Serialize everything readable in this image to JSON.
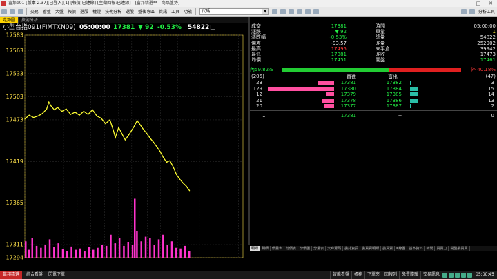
{
  "window": {
    "title": "富邦e01 [版本 2.37][已登入][1] [報價:已連線] [主動回報:已連線] - [富邦精選** - 商品盤勢]",
    "min": "─",
    "max": "□",
    "close": "✕"
  },
  "toolbar": {
    "menus": [
      "交易",
      "看盤",
      "大盤",
      "報價",
      "選股",
      "權證",
      "技術分析",
      "選股",
      "盤後專區",
      "資訊",
      "工具",
      "功能"
    ],
    "combo_value": "代碼",
    "right_label": "分析工具"
  },
  "chart_tabs": [
    "走勢圖",
    "技術分析"
  ],
  "header": {
    "product": "小型台指091(FIMTXN09)",
    "time": "05:00:00",
    "price": "17381",
    "arrow": "▼",
    "change": "92",
    "percent": "-0.53%",
    "volume": "54822"
  },
  "chart_data": {
    "type": "line",
    "ylim": [
      17294,
      17583
    ],
    "yticks": [
      "17583",
      "17563",
      "17533",
      "17503",
      "17473",
      "17419",
      "17365",
      "17311",
      "17294"
    ],
    "ytick_values": [
      17583,
      17563,
      17533,
      17503,
      17473,
      17419,
      17365,
      17311,
      17294
    ],
    "xticks": [
      "15",
      "17",
      "18",
      "19",
      "20",
      "21",
      "22",
      "23",
      "0",
      "1",
      "3",
      "5:00/8:45",
      "11",
      "12",
      "13:45"
    ],
    "xtick_positions": [
      0,
      0.115,
      0.177,
      0.24,
      0.302,
      0.365,
      0.43,
      0.49,
      0.562,
      0.622,
      0.7,
      0.8,
      0.922,
      0.98,
      1.06
    ],
    "price": [
      [
        0,
        17474
      ],
      [
        0.02,
        17479
      ],
      [
        0.04,
        17476
      ],
      [
        0.06,
        17478
      ],
      [
        0.08,
        17481
      ],
      [
        0.1,
        17487
      ],
      [
        0.11,
        17496
      ],
      [
        0.12,
        17491
      ],
      [
        0.135,
        17486
      ],
      [
        0.15,
        17489
      ],
      [
        0.17,
        17484
      ],
      [
        0.19,
        17487
      ],
      [
        0.21,
        17480
      ],
      [
        0.23,
        17483
      ],
      [
        0.25,
        17479
      ],
      [
        0.27,
        17484
      ],
      [
        0.29,
        17480
      ],
      [
        0.31,
        17486
      ],
      [
        0.33,
        17478
      ],
      [
        0.35,
        17475
      ],
      [
        0.37,
        17468
      ],
      [
        0.39,
        17473
      ],
      [
        0.405,
        17460
      ],
      [
        0.415,
        17450
      ],
      [
        0.43,
        17463
      ],
      [
        0.445,
        17455
      ],
      [
        0.46,
        17447
      ],
      [
        0.48,
        17455
      ],
      [
        0.5,
        17464
      ],
      [
        0.515,
        17472
      ],
      [
        0.53,
        17466
      ],
      [
        0.545,
        17460
      ],
      [
        0.56,
        17455
      ],
      [
        0.575,
        17449
      ],
      [
        0.59,
        17444
      ],
      [
        0.605,
        17438
      ],
      [
        0.62,
        17432
      ],
      [
        0.635,
        17424
      ],
      [
        0.65,
        17418
      ],
      [
        0.665,
        17420
      ],
      [
        0.68,
        17412
      ],
      [
        0.695,
        17402
      ],
      [
        0.71,
        17396
      ],
      [
        0.725,
        17391
      ],
      [
        0.74,
        17387
      ],
      [
        0.755,
        17381
      ]
    ],
    "volume": [
      [
        0,
        0.25
      ],
      [
        0.015,
        0.12
      ],
      [
        0.03,
        0.3
      ],
      [
        0.05,
        0.18
      ],
      [
        0.07,
        0.15
      ],
      [
        0.09,
        0.2
      ],
      [
        0.11,
        0.28
      ],
      [
        0.13,
        0.16
      ],
      [
        0.15,
        0.22
      ],
      [
        0.17,
        0.13
      ],
      [
        0.19,
        0.1
      ],
      [
        0.21,
        0.17
      ],
      [
        0.23,
        0.12
      ],
      [
        0.25,
        0.14
      ],
      [
        0.27,
        0.1
      ],
      [
        0.29,
        0.16
      ],
      [
        0.31,
        0.12
      ],
      [
        0.33,
        0.15
      ],
      [
        0.35,
        0.2
      ],
      [
        0.37,
        0.18
      ],
      [
        0.39,
        0.35
      ],
      [
        0.41,
        0.22
      ],
      [
        0.43,
        0.3
      ],
      [
        0.45,
        0.18
      ],
      [
        0.47,
        0.24
      ],
      [
        0.49,
        0.2
      ],
      [
        0.5,
        0.9
      ],
      [
        0.51,
        0.4
      ],
      [
        0.53,
        0.25
      ],
      [
        0.55,
        0.32
      ],
      [
        0.57,
        0.3
      ],
      [
        0.59,
        0.2
      ],
      [
        0.61,
        0.28
      ],
      [
        0.63,
        0.35
      ],
      [
        0.65,
        0.2
      ],
      [
        0.67,
        0.25
      ],
      [
        0.69,
        0.15
      ],
      [
        0.71,
        0.14
      ],
      [
        0.73,
        0.18
      ],
      [
        0.75,
        0.1
      ]
    ],
    "price_color": "#ffff33",
    "volume_color": "#ff33cc",
    "grid_color": "#333333",
    "axis_color": "#ffe24a"
  },
  "quote": {
    "rows": [
      {
        "l1": "成交",
        "v1": "17381",
        "c1": "green",
        "l2": "時間",
        "v2": "05:00:00",
        "c2": "white"
      },
      {
        "l1": "漲跌",
        "v1": "▼ 92",
        "c1": "green",
        "l2": "單量",
        "v2": "1",
        "c2": "yellow"
      },
      {
        "l1": "漲跌幅",
        "v1": "-0.53%",
        "c1": "green",
        "l2": "總量",
        "v2": "54822",
        "c2": "white"
      },
      {
        "l1": "價差",
        "v1": "-93.57",
        "c1": "white",
        "l2": "昨量",
        "v2": "252902",
        "c2": "white"
      },
      {
        "l1": "最高",
        "v1": "17495",
        "c1": "red",
        "l2": "未平倉",
        "v2": "39942",
        "c2": "white"
      },
      {
        "l1": "最低",
        "v1": "17381",
        "c1": "green",
        "l2": "昨收",
        "v2": "17473",
        "c2": "white"
      },
      {
        "l1": "均價",
        "v1": "17451",
        "c1": "green",
        "l2": "開盤",
        "v2": "17461",
        "c2": "green"
      }
    ],
    "ratio": {
      "inner_label": "內59.82%",
      "outer_label": "外 40.18%",
      "inner_pct": 59.82
    },
    "book_header": {
      "bid_total": "(205)",
      "bid_title": "買進",
      "ask_title": "賣出",
      "ask_total": "(47)"
    },
    "book": [
      {
        "bq": "23",
        "bp": "17381",
        "ap": "17382",
        "aq": "3",
        "bf": 0.25,
        "af": 0.1
      },
      {
        "bq": "129",
        "bp": "17380",
        "ap": "17384",
        "aq": "15",
        "bf": 1.0,
        "af": 0.55
      },
      {
        "bq": "12",
        "bp": "17379",
        "ap": "17385",
        "aq": "14",
        "bf": 0.12,
        "af": 0.5
      },
      {
        "bq": "21",
        "bp": "17378",
        "ap": "17386",
        "aq": "13",
        "bf": 0.18,
        "af": 0.5
      },
      {
        "bq": "20",
        "bp": "17377",
        "ap": "17387",
        "aq": "2",
        "bf": 0.16,
        "af": 0.08
      }
    ],
    "last": {
      "q": "1",
      "p": "17381",
      "ap": "--",
      "aq": "0"
    }
  },
  "sheet_tabs": [
    "明細",
    "明細",
    "價量表",
    "分價表",
    "分價圖",
    "分量表",
    "大戶籌碼",
    "委託資訊",
    "委買賣明細",
    "委買賣",
    "K線圖",
    "基本資料",
    "新聞",
    "買賣力",
    "開盤委買賣"
  ],
  "footer": {
    "tab_active": "當邦精選",
    "tab2": "綜合看盤",
    "tab3": "閃電下單",
    "buttons": [
      "智能看盤",
      "帳務",
      "下單夾",
      "回報列",
      "免費體驗",
      "交易訊息"
    ],
    "clock": "05:00:45"
  }
}
